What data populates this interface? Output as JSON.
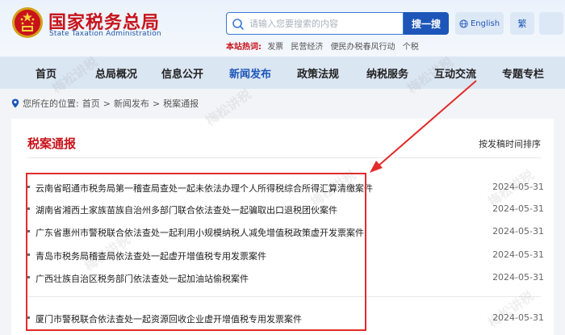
{
  "header": {
    "title": "国家税务总局",
    "subtitle": "State Taxation Administration"
  },
  "search": {
    "placeholder": "请输入您要搜索的内容",
    "button": "搜一搜"
  },
  "lang": {
    "english": "English",
    "traditional": "繁"
  },
  "hot": {
    "label": "本站热词:",
    "items": [
      "发票",
      "民营经济",
      "便民办税春风行动",
      "个税"
    ]
  },
  "nav": {
    "items": [
      "首页",
      "总局概况",
      "信息公开",
      "新闻发布",
      "政策法规",
      "纳税服务",
      "互动交流",
      "专题专栏"
    ],
    "active_index": 3
  },
  "breadcrumb": {
    "prefix": "您所在的位置:",
    "items": [
      "首页",
      "新闻发布",
      "税案通报"
    ],
    "sep": ">"
  },
  "panel": {
    "title": "税案通报",
    "sort": "按发稿时间排序",
    "rows": [
      {
        "title": "云南省昭通市税务局第一稽查局查处一起未依法办理个人所得税综合所得汇算清缴案件",
        "date": "2024-05-31"
      },
      {
        "title": "湖南省湘西土家族苗族自治州多部门联合依法查处一起骗取出口退税团伙案件",
        "date": "2024-05-31"
      },
      {
        "title": "广东省惠州市警税联合依法查处一起利用小规模纳税人减免增值税政策虚开发票案件",
        "date": "2024-05-31"
      },
      {
        "title": "青岛市税务局稽查局依法查处一起虚开增值税专用发票案件",
        "date": "2024-05-31"
      },
      {
        "title": "广西壮族自治区税务部门依法查处一起加油站偷税案件",
        "date": "2024-05-31"
      },
      {
        "title": "厦门市警税联合依法查处一起资源回收企业虚开增值税专用发票案件",
        "date": "2024-05-31"
      }
    ]
  },
  "watermark": "梅松讲税",
  "colors": {
    "brand_red": "#c8131b",
    "brand_blue": "#1d56b8",
    "annotation_red": "#e32b2b"
  }
}
